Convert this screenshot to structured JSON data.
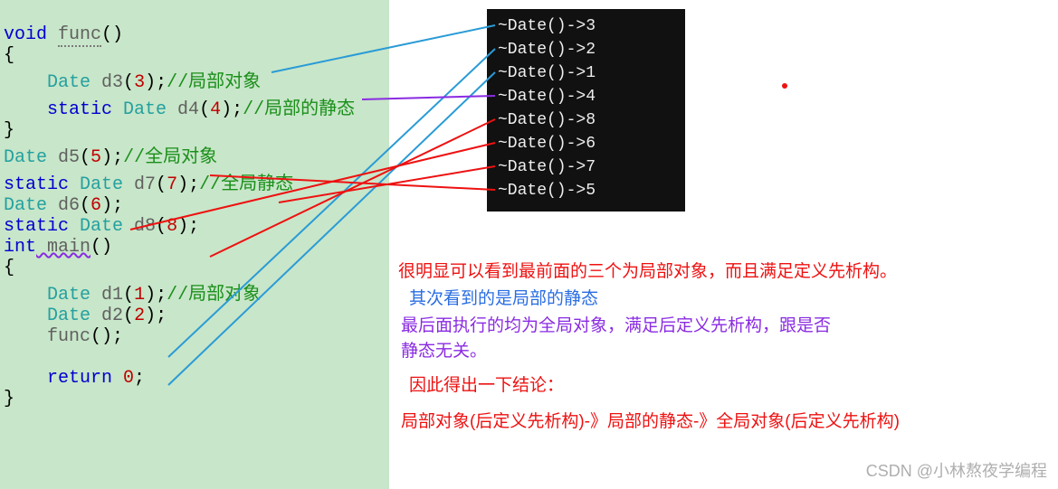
{
  "code": {
    "l1_kw": "void",
    "l1_name": "func",
    "l1_paren": "()",
    "l2": "{",
    "l3_in": "    ",
    "l3_type": "Date",
    "l3_id": " d3",
    "l3_op": "(",
    "l3_num": "3",
    "l3_cp": ");",
    "l3_comment": "//局部对象",
    "l4_in": "    ",
    "l4_kw": "static ",
    "l4_type": "Date",
    "l4_id": " d4",
    "l4_op": "(",
    "l4_num": "4",
    "l4_cp": ");",
    "l4_comment": "//局部的静态",
    "l5": "}",
    "l6_type": "Date",
    "l6_id": " d5",
    "l6_op": "(",
    "l6_num": "5",
    "l6_cp": ");",
    "l6_comment": "//全局对象",
    "l7_kw": "static ",
    "l7_type": "Date",
    "l7_id": " d7",
    "l7_op": "(",
    "l7_num": "7",
    "l7_cp": ");",
    "l7_comment": "//全局静态",
    "l8_type": "Date",
    "l8_id": " d6",
    "l8_op": "(",
    "l8_num": "6",
    "l8_cp": ");",
    "l9_kw": "static ",
    "l9_type": "Date",
    "l9_id": " d8",
    "l9_op": "(",
    "l9_num": "8",
    "l9_cp": ");",
    "l10_kw": "int",
    "l10_name": " main",
    "l10_paren": "()",
    "l11": "{",
    "l12_in": "    ",
    "l12_type": "Date",
    "l12_id": " d1",
    "l12_op": "(",
    "l12_num": "1",
    "l12_cp": ");",
    "l12_comment": "//局部对象",
    "l13_in": "    ",
    "l13_type": "Date",
    "l13_id": " d2",
    "l13_op": "(",
    "l13_num": "2",
    "l13_cp": ");",
    "l14_in": "    ",
    "l14_call": "func",
    "l14_paren": "();",
    "l15": "",
    "l16_in": "    ",
    "l16_kw": "return ",
    "l16_num": "0",
    "l16_sc": ";",
    "l17": "}"
  },
  "console": {
    "lines": [
      "~Date()->3",
      "~Date()->2",
      "~Date()->1",
      "~Date()->4",
      "~Date()->8",
      "~Date()->6",
      "~Date()->7",
      "~Date()->5"
    ]
  },
  "notes": {
    "n1": "很明显可以看到最前面的三个为局部对象，而且满足定义先析构。",
    "n2": "其次看到的是局部的静态",
    "n3a": "最后面执行的均为全局对象，满足后定义先析构，跟是否",
    "n3b": "静态无关。",
    "n4": "因此得出一下结论：",
    "n5": "局部对象(后定义先析构)-》局部的静态-》全局对象(后定义先析构)"
  },
  "watermark": "CSDN @小林熬夜学编程"
}
